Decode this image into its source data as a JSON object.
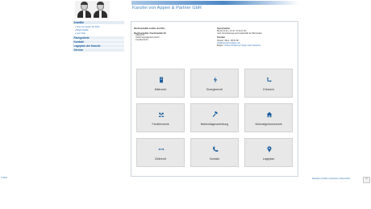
{
  "header": {
    "title": "Kanzlei von Appen & Partner GbR"
  },
  "sidebar": {
    "items": [
      {
        "label": "Anwälte"
      },
      {
        "label": "Fachgebiete"
      },
      {
        "label": "Kontakt"
      },
      {
        "label": "Lageplan der Kanzlei"
      },
      {
        "label": "Service"
      }
    ],
    "subitems": [
      {
        "label": "Jens von Appen bis 2012"
      },
      {
        "label": "Birgitt Liedke"
      },
      {
        "label": "Leon Otto"
      }
    ]
  },
  "info": {
    "subtitle": "Rechtsanwälte Liedke und Otto",
    "areas_heading": "Rechtsanwälte / Fachanwälte für",
    "areas": [
      "Mietrecht",
      "Wohnungseigentumsrecht",
      "Familienrecht"
    ],
    "hours_heading": "Sprechzeiten",
    "hours_1": "Mo-Do 8-12 + 14-17; Fr 8-12 Uhr",
    "hours_2": "nach Vereinbarung auch außerhalb der Bürozeiten",
    "contact_heading": "Kontakt",
    "phone": "Telefon: 0421 / 38 81 85",
    "email": "info@kanzleivonappen.de",
    "blog_prefix": "Blogen:",
    "blog_links": "Online Kontakt per Skype oder Facetime"
  },
  "tiles": [
    {
      "label": "Mietrecht",
      "icon": "building-icon"
    },
    {
      "label": "Energierecht",
      "icon": "lightning-icon"
    },
    {
      "label": "Erbrecht",
      "icon": "arrows-icon"
    },
    {
      "label": "Familienrecht",
      "icon": "family-icon"
    },
    {
      "label": "Nebenklagevertretung",
      "icon": "gavel-icon"
    },
    {
      "label": "Wohneigentumsrecht",
      "icon": "home-icon"
    },
    {
      "label": "Zivilrecht",
      "icon": "arrows-horizontal-icon"
    },
    {
      "label": "Kontakt",
      "icon": "phone-icon"
    },
    {
      "label": "Lageplan",
      "icon": "map-pin-icon"
    }
  ],
  "footer": {
    "copyright": "© 2024",
    "links": "Startseite | Kontakt | Impressum | Datenschutz"
  },
  "colors": {
    "accent": "#1b5e9e",
    "link": "#2a72b8",
    "title": "#4a86c2",
    "tile_bg": "#e8e8e8"
  }
}
